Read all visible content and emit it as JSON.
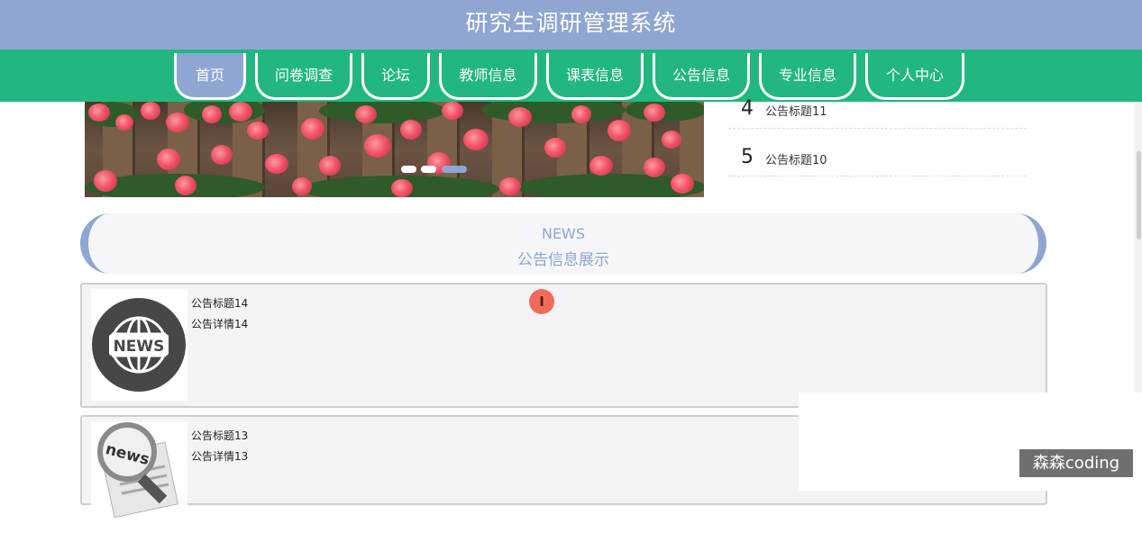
{
  "app": {
    "title": "研究生调研管理系统"
  },
  "nav": {
    "items": [
      {
        "label": "首页",
        "active": true
      },
      {
        "label": "问卷调查",
        "active": false
      },
      {
        "label": "论坛",
        "active": false
      },
      {
        "label": "教师信息",
        "active": false
      },
      {
        "label": "课表信息",
        "active": false
      },
      {
        "label": "公告信息",
        "active": false
      },
      {
        "label": "专业信息",
        "active": false
      },
      {
        "label": "个人中心",
        "active": false
      }
    ]
  },
  "carousel": {
    "slide_count": 3,
    "active_index": 2
  },
  "notice_list": [
    {
      "num": "4",
      "title": "公告标题11"
    },
    {
      "num": "5",
      "title": "公告标题10"
    }
  ],
  "news_section": {
    "title_en": "NEWS",
    "title_cn": "公告信息展示"
  },
  "news_items": [
    {
      "title": "公告标题14",
      "detail": "公告详情14",
      "thumb": "news-globe-icon",
      "thumb_text": "NEWS"
    },
    {
      "title": "公告标题13",
      "detail": "公告详情13",
      "thumb": "news-magnifier-icon",
      "thumb_text": "news"
    }
  ],
  "watermark": "森森coding",
  "colors": {
    "header": "#8fa6d3",
    "nav": "#22b77f",
    "accent": "#8fa6d3"
  }
}
